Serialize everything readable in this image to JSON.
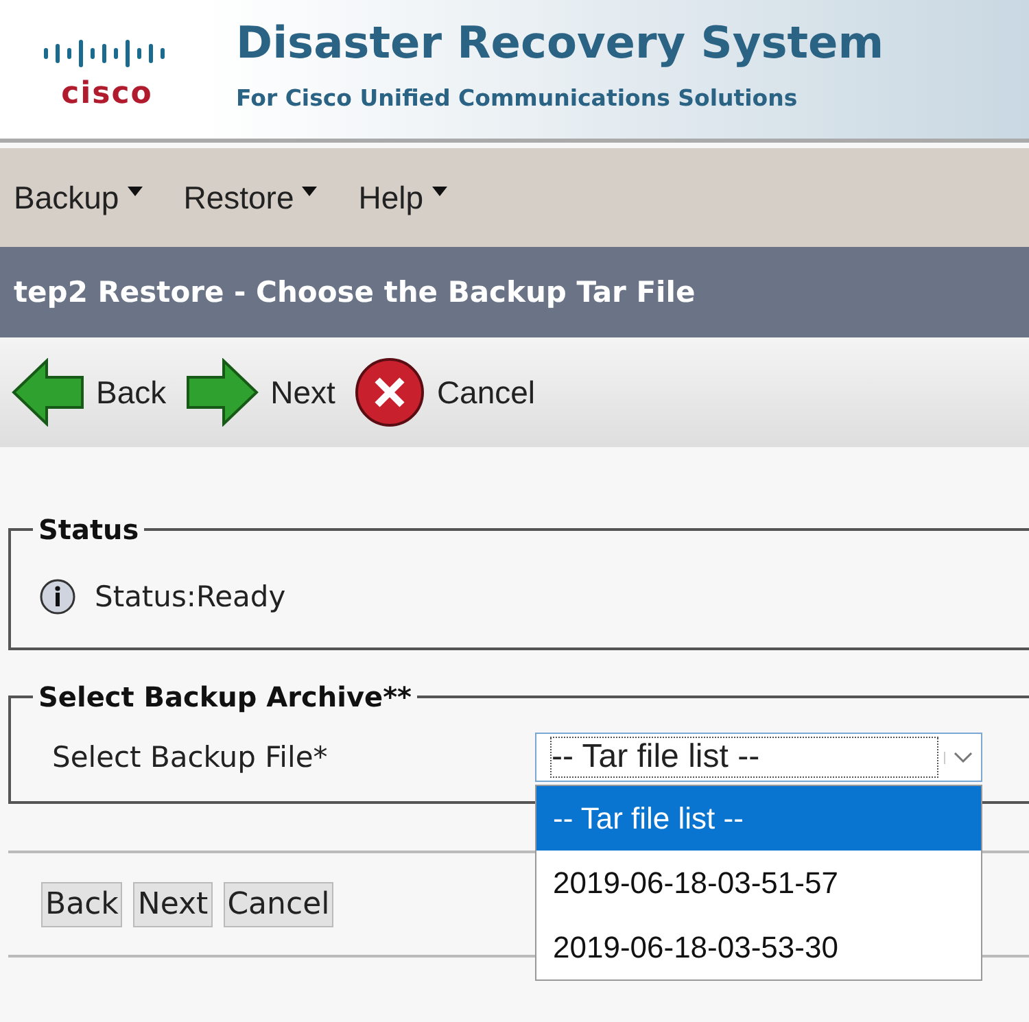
{
  "header": {
    "logo": "cisco",
    "title": "Disaster Recovery System",
    "subtitle": "For Cisco Unified Communications Solutions"
  },
  "menu": [
    "Backup",
    "Restore",
    "Help"
  ],
  "page_title": "tep2 Restore - Choose the Backup Tar File",
  "toolbar": [
    {
      "kind": "back",
      "label": "Back"
    },
    {
      "kind": "next",
      "label": "Next"
    },
    {
      "kind": "cancel",
      "label": "Cancel"
    }
  ],
  "status": {
    "legend": "Status",
    "text": "Status:Ready"
  },
  "archive": {
    "legend": "Select Backup Archive**",
    "label": "Select Backup File*",
    "value": "-- Tar file list --",
    "options": [
      {
        "label": "-- Tar file list --",
        "selected": true
      },
      {
        "label": "2019-06-18-03-51-57",
        "selected": false
      },
      {
        "label": "2019-06-18-03-53-30",
        "selected": false
      }
    ]
  },
  "buttons": [
    "Back",
    "Next",
    "Cancel"
  ]
}
